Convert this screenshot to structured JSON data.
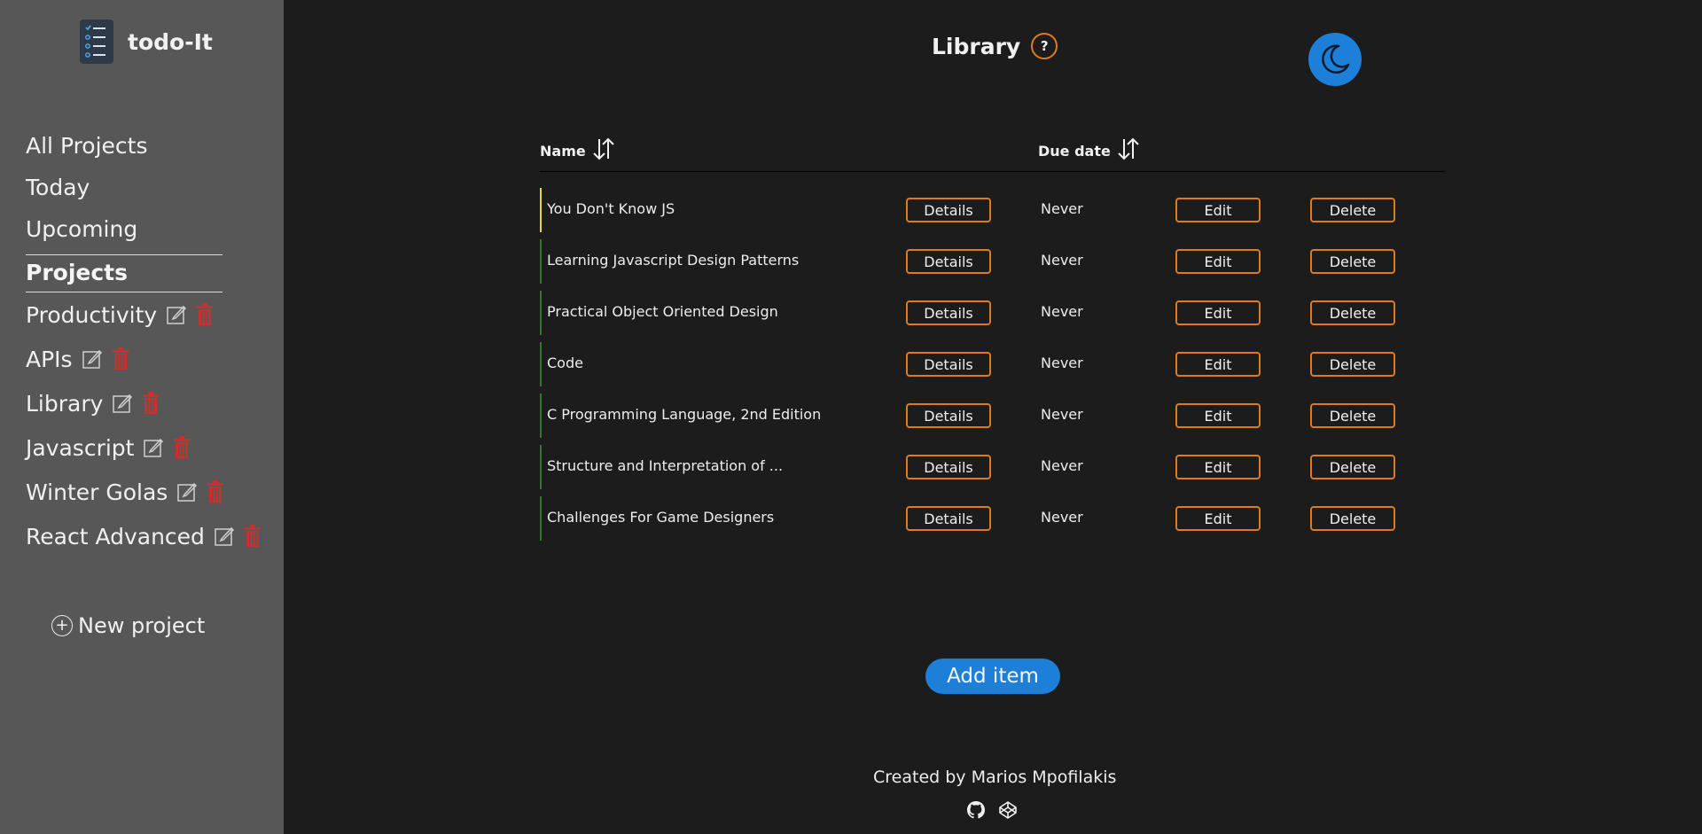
{
  "app": {
    "title": "todo-It"
  },
  "sidebar": {
    "nav": [
      {
        "label": "All Projects"
      },
      {
        "label": "Today"
      },
      {
        "label": "Upcoming"
      }
    ],
    "projects_heading": "Projects",
    "projects": [
      {
        "label": "Productivity"
      },
      {
        "label": "APIs"
      },
      {
        "label": "Library"
      },
      {
        "label": "Javascript"
      },
      {
        "label": "Winter Golas"
      },
      {
        "label": "React Advanced"
      }
    ],
    "new_project_label": "New project",
    "new_project_icon": "+"
  },
  "header": {
    "title": "Library",
    "help_label": "?"
  },
  "table": {
    "columns": {
      "name": "Name",
      "due": "Due date"
    },
    "rows": [
      {
        "name": "You Don't Know JS",
        "due": "Never",
        "priority_color": "#f0d23a"
      },
      {
        "name": "Learning Javascript Design Patterns",
        "due": "Never",
        "priority_color": "#2a7a2a"
      },
      {
        "name": "Practical Object Oriented Design",
        "due": "Never",
        "priority_color": "#2a7a2a"
      },
      {
        "name": "Code",
        "due": "Never",
        "priority_color": "#2a7a2a"
      },
      {
        "name": "C Programming Language, 2nd Edition",
        "due": "Never",
        "priority_color": "#2a7a2a"
      },
      {
        "name": "Structure and Interpretation of ...",
        "due": "Never",
        "priority_color": "#2a7a2a"
      },
      {
        "name": "Challenges For Game Designers",
        "due": "Never",
        "priority_color": "#2a7a2a"
      }
    ],
    "details_label": "Details",
    "edit_label": "Edit",
    "delete_label": "Delete"
  },
  "add_item_label": "Add item",
  "footer": {
    "credit": "Created by Marios Mpofilakis"
  },
  "colors": {
    "accent": "#e07a1f",
    "primary": "#1d7fd8",
    "delete_icon": "#c9302c",
    "sidebar_bg": "#575757",
    "main_bg": "#1c1c1c"
  },
  "icons": [
    "checklist-logo-icon",
    "help-icon",
    "moon-icon",
    "sort-icon",
    "edit-icon",
    "trash-icon",
    "plus-circle-icon",
    "github-icon",
    "codepen-icon"
  ]
}
